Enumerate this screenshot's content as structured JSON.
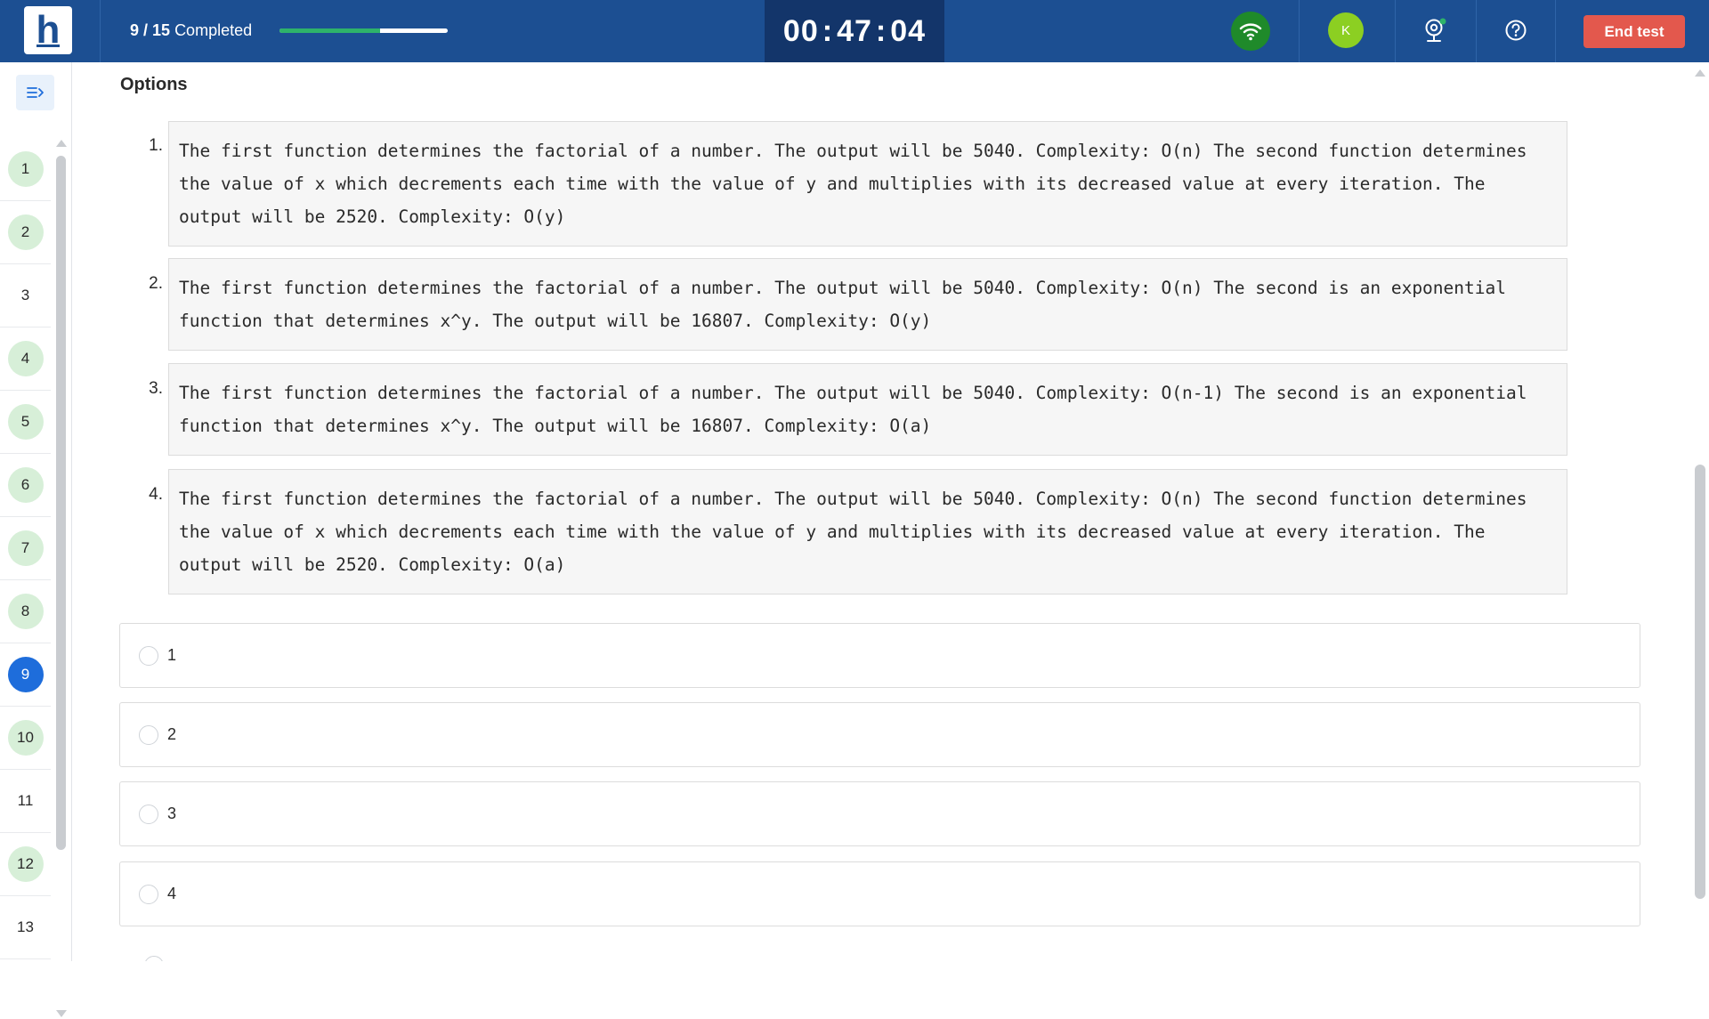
{
  "header": {
    "logo_letter": "h",
    "progress": {
      "completed": "9 / 15",
      "suffix": "Completed",
      "fraction": 0.6
    },
    "timer": {
      "hours": "00",
      "minutes": "47",
      "seconds": "04"
    },
    "avatar_initial": "K",
    "end_test_label": "End test",
    "icons": [
      "wifi-icon",
      "webcam-icon",
      "help-icon"
    ]
  },
  "sidebar": {
    "questions": [
      {
        "num": "1",
        "state": "answered"
      },
      {
        "num": "2",
        "state": "answered"
      },
      {
        "num": "3",
        "state": "unanswered"
      },
      {
        "num": "4",
        "state": "answered"
      },
      {
        "num": "5",
        "state": "answered"
      },
      {
        "num": "6",
        "state": "answered"
      },
      {
        "num": "7",
        "state": "answered"
      },
      {
        "num": "8",
        "state": "answered"
      },
      {
        "num": "9",
        "state": "current"
      },
      {
        "num": "10",
        "state": "answered"
      },
      {
        "num": "11",
        "state": "unanswered"
      },
      {
        "num": "12",
        "state": "answered"
      },
      {
        "num": "13",
        "state": "unanswered"
      }
    ]
  },
  "main": {
    "options_heading": "Options",
    "options": [
      {
        "index": "1.",
        "text": "The first function determines the factorial of a number. The output will be 5040. Complexity: O(n) The second function determines the value of x which decrements each time with the value of y and multiplies with its decreased value at every iteration. The output will be 2520. Complexity: O(y)"
      },
      {
        "index": "2.",
        "text": "The first function determines the factorial of a number. The output will be 5040. Complexity: O(n) The second is an exponential function that determines x^y. The output will be 16807. Complexity: O(y)"
      },
      {
        "index": "3.",
        "text": "The first function determines the factorial of a number. The output will be 5040. Complexity: O(n-1) The second is an exponential function that determines x^y. The output will be 16807. Complexity: O(a)"
      },
      {
        "index": "4.",
        "text": "The first function determines the factorial of a number. The output will be 5040. Complexity: O(n) The second function determines the value of x which decrements each time with the value of y and multiplies with its decreased value at every iteration. The output will be 2520. Complexity: O(a)"
      }
    ],
    "choices": [
      "1",
      "2",
      "3",
      "4"
    ]
  },
  "colors": {
    "header_bg": "#1c4f92",
    "timer_bg": "#13356a",
    "progress_fill": "#2eb36a",
    "end_test_bg": "#e3584d",
    "answered_bg": "#d7efd8",
    "current_bg": "#1e6ddb",
    "wifi_bg": "#1f8a2a",
    "avatar_bg": "#8ccf22"
  }
}
